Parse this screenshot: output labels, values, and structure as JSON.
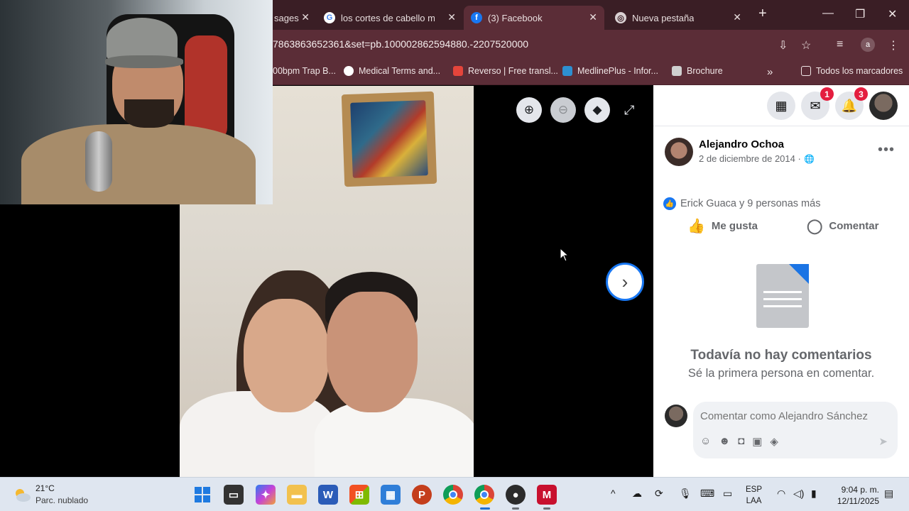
{
  "browser": {
    "tabs": [
      {
        "label": "sages"
      },
      {
        "label": "los cortes de cabello mas"
      },
      {
        "label": "(3) Facebook"
      },
      {
        "label": "Nueva pestaña"
      }
    ],
    "url": "7863863652361&set=pb.100002862594880.-2207520000",
    "profile_initial": "a",
    "bookmarks": [
      {
        "label": "00bpm Trap B..."
      },
      {
        "label": "Medical Terms and..."
      },
      {
        "label": "Reverso | Free transl..."
      },
      {
        "label": "MedlinePlus - Infor..."
      },
      {
        "label": "Brochure"
      },
      {
        "label": "Todos los marcadores"
      }
    ]
  },
  "facebook": {
    "messenger_badge": "1",
    "notifications_badge": "3",
    "post": {
      "author": "Alejandro Ochoa",
      "date": "2 de diciembre de 2014",
      "date_separator": "·",
      "reactions": "Erick Guaca y 9 personas más",
      "like_label": "Me gusta",
      "comment_label": "Comentar"
    },
    "empty": {
      "title": "Todavía no hay comentarios",
      "subtitle": "Sé la primera persona en comentar."
    },
    "comment_placeholder": "Comentar como Alejandro Sánchez"
  },
  "taskbar": {
    "temperature": "21°C",
    "condition": "Parc. nublado",
    "lang_top": "ESP",
    "lang_bottom": "LAA",
    "time": "9:04 p. m.",
    "date": "12/11/2025"
  },
  "icons": {
    "zoom_in": "zoom-in-icon",
    "zoom_out": "zoom-out-icon",
    "tag": "tag-icon",
    "expand": "expand-icon",
    "next": "chevron-right-icon"
  }
}
